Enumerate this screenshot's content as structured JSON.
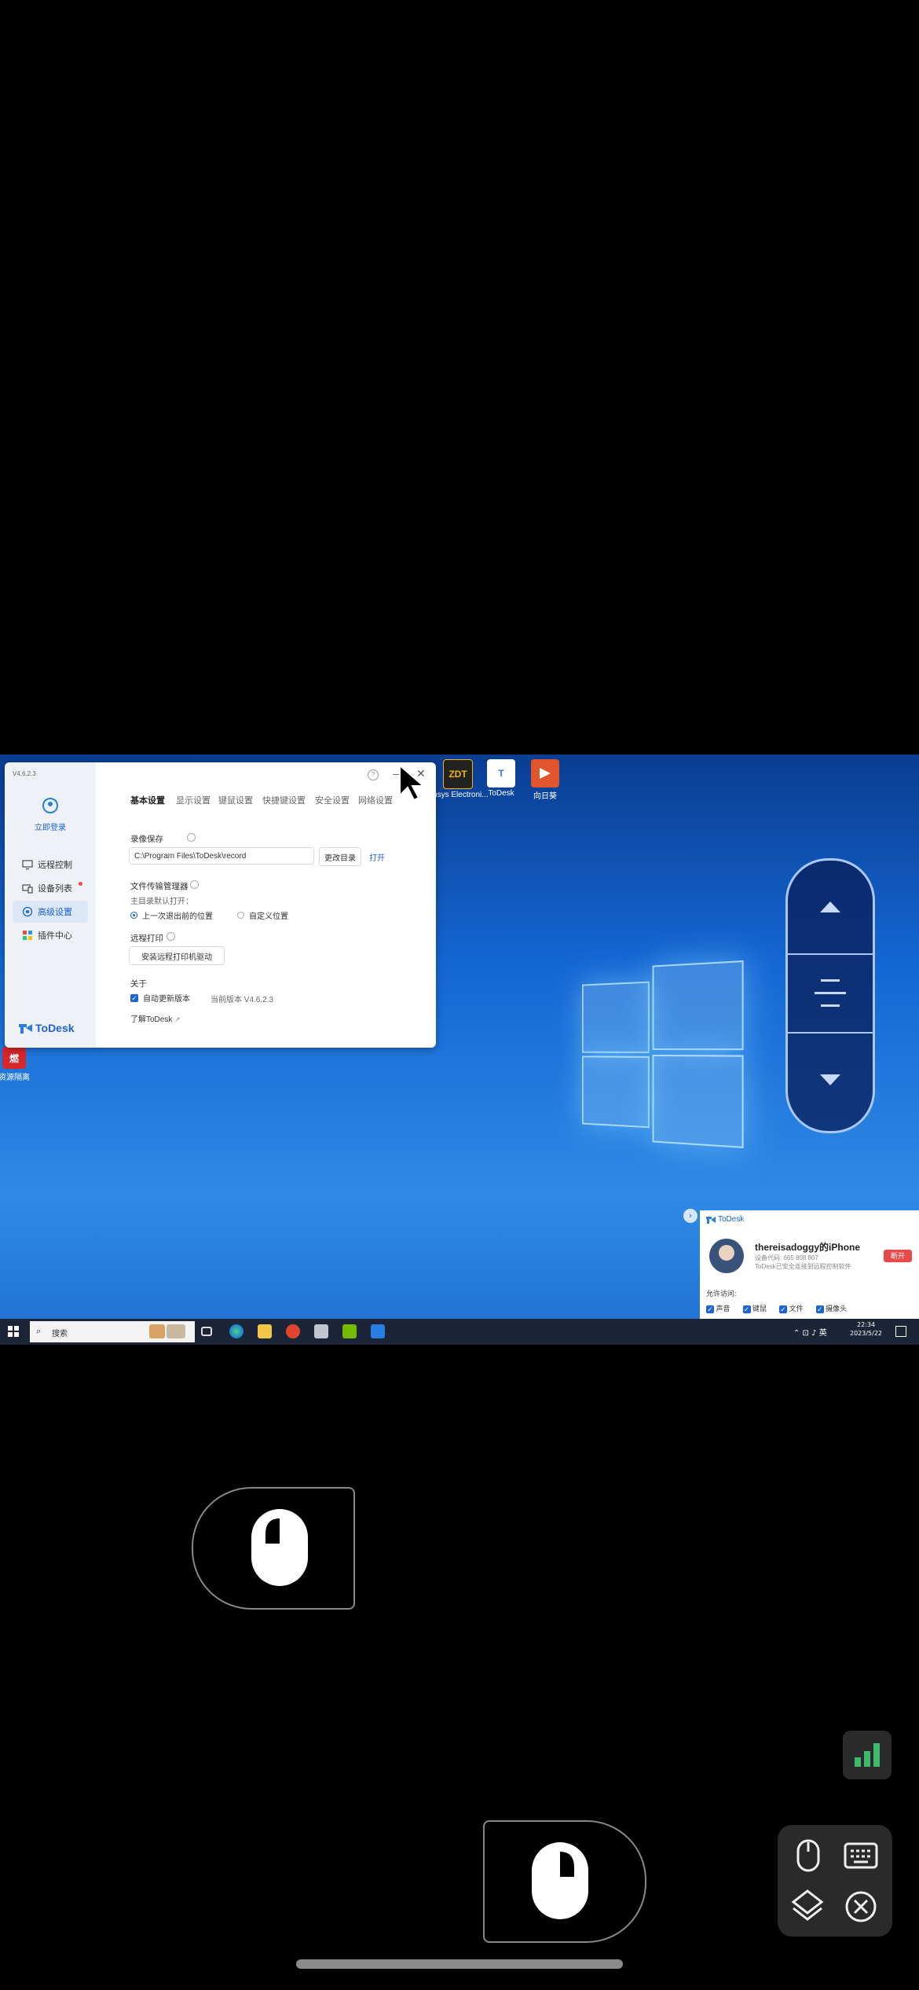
{
  "desktop_icons": [
    {
      "label": "Ansys Electroni...",
      "badge": "ZDT",
      "color": "#2b2b2b"
    },
    {
      "label": "ToDesk",
      "badge": "T",
      "color": "#2a7de1"
    },
    {
      "label": "向日葵",
      "badge": "",
      "color": "#e2542b"
    }
  ],
  "left_desktop_icon": {
    "label": "资源隔离",
    "badge": "燃"
  },
  "todesk": {
    "version": "V4.6.2.3",
    "login_label": "立即登录",
    "sidebar": [
      {
        "label": "远程控制",
        "icon": "monitor-icon",
        "active": false
      },
      {
        "label": "设备列表",
        "icon": "devices-icon",
        "active": false,
        "dot": true
      },
      {
        "label": "高级设置",
        "icon": "settings-icon",
        "active": true
      },
      {
        "label": "插件中心",
        "icon": "plugins-icon",
        "active": false
      }
    ],
    "brand": "ToDesk",
    "tabs": [
      "基本设置",
      "显示设置",
      "键鼠设置",
      "快捷键设置",
      "安全设置",
      "网络设置"
    ],
    "record_title": "录像保存",
    "record_path": "C:\\Program Files\\ToDesk\\record",
    "change_dir": "更改目录",
    "open": "打开",
    "file_mgr_title": "文件传输管理器",
    "default_open": "主目录默认打开：",
    "radio_last": "上一次退出前的位置",
    "radio_custom": "自定义位置",
    "remote_print_title": "远程打印",
    "install_printer": "安装远程打印机驱动",
    "about_title": "关于",
    "auto_update": "自动更新版本",
    "current_version": "当前版本 V4.6.2.3",
    "learn_more": "了解ToDesk"
  },
  "taskbar": {
    "search": "搜索",
    "tray_text": "英",
    "time": "22:34",
    "date": "2023/5/22"
  },
  "notification": {
    "brand": "ToDesk",
    "name": "thereisadoggy的iPhone",
    "device_code": "设备代码: 665 808 807",
    "desc": "ToDesk已安全连接到远程控制软件",
    "disconnect": "断开",
    "allow_label": "允许访问:",
    "perms": [
      "声音",
      "键鼠",
      "文件",
      "摄像头"
    ]
  }
}
